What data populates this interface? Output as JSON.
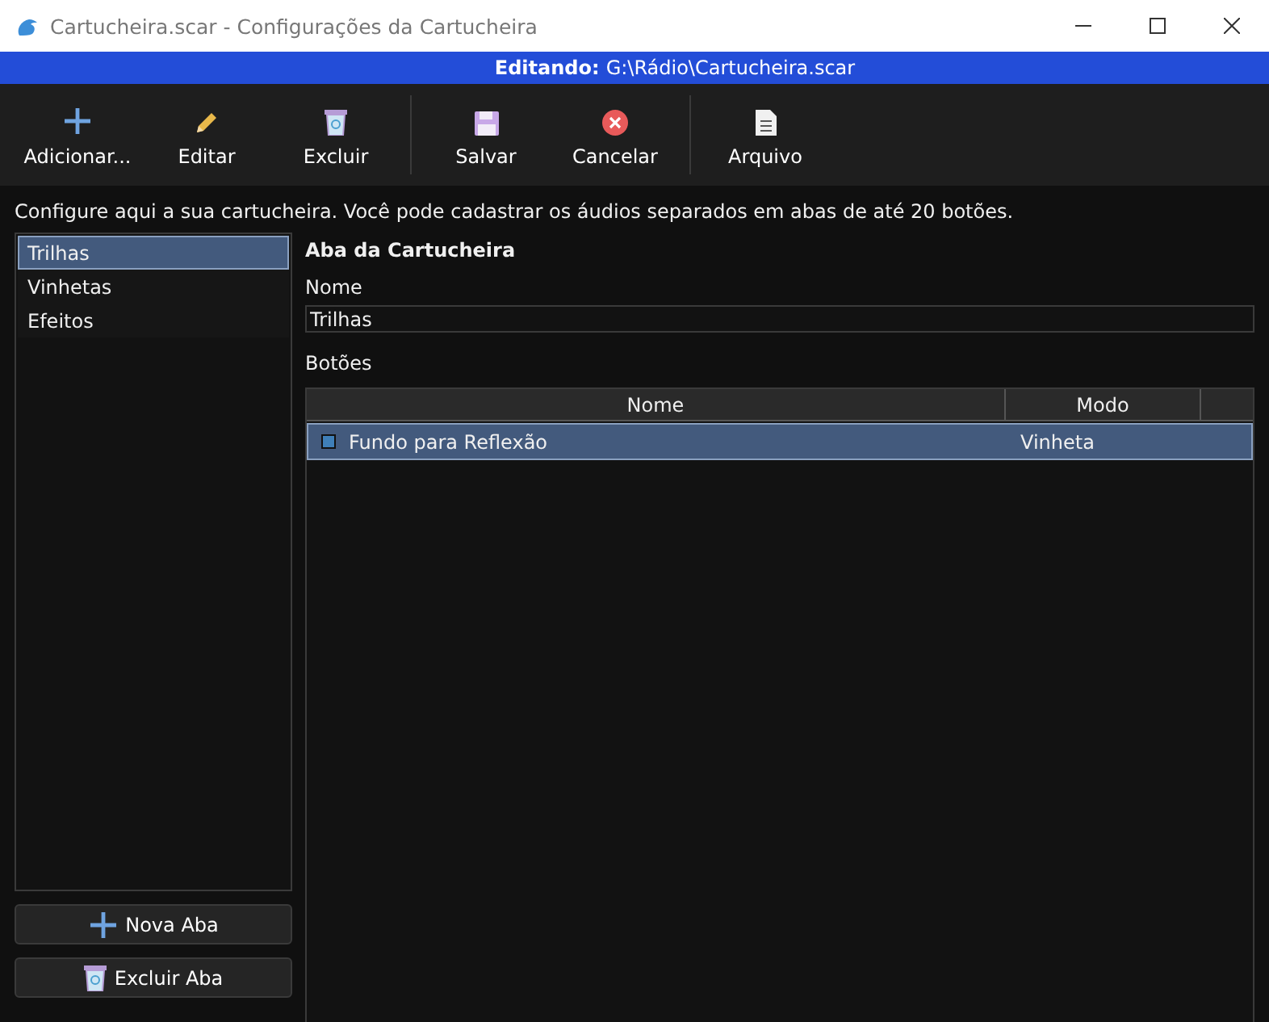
{
  "window": {
    "title": "Cartucheira.scar - Configurações da Cartucheira"
  },
  "path_bar": {
    "label": "Editando:",
    "path": "G:\\Rádio\\Cartucheira.scar"
  },
  "toolbar": {
    "groups": [
      [
        {
          "label": "Adicionar...",
          "kind": "plus"
        },
        {
          "label": "Editar",
          "kind": "pencil"
        },
        {
          "label": "Excluir",
          "kind": "trash"
        }
      ],
      [
        {
          "label": "Salvar",
          "kind": "save"
        },
        {
          "label": "Cancelar",
          "kind": "cancel"
        }
      ],
      [
        {
          "label": "Arquivo",
          "kind": "file"
        }
      ]
    ]
  },
  "intro": "Configure aqui a sua cartucheira. Você pode cadastrar os áudios separados em abas de até 20 botões.",
  "tabs": [
    {
      "label": "Trilhas",
      "selected": true
    },
    {
      "label": "Vinhetas",
      "selected": false
    },
    {
      "label": "Efeitos",
      "selected": false
    }
  ],
  "tab_buttons": [
    {
      "label": "Nova Aba",
      "kind": "plus"
    },
    {
      "label": "Excluir Aba",
      "kind": "trash"
    }
  ],
  "editor": {
    "heading": "Aba da Cartucheira",
    "name_label": "Nome",
    "name_value": "Trilhas",
    "buttons_label": "Botões",
    "table": {
      "columns": [
        "Nome",
        "Modo"
      ],
      "rows": [
        {
          "name": "Fundo para Reflexão",
          "mode": "Vinheta",
          "selected": true
        }
      ]
    }
  }
}
